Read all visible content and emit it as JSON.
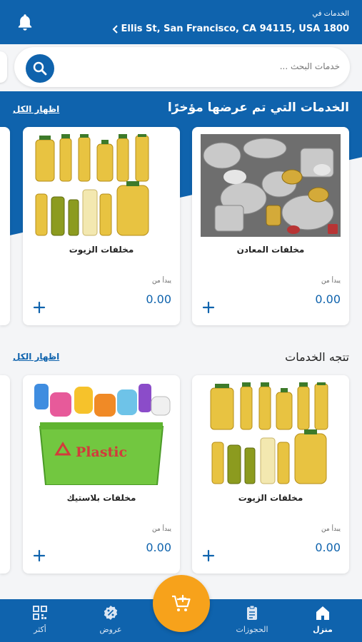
{
  "header": {
    "label": "الخدمات في",
    "address": "Ellis St, San Francisco, CA 94115, USA 1800"
  },
  "search": {
    "placeholder": "خدمات البحث ..."
  },
  "recent": {
    "title": "الخدمات التي تم عرضها مؤخرًا",
    "show_all": "اظهار الكل",
    "cards": [
      {
        "name": "مخلفات المعادن",
        "from": "يبدأ من",
        "price": "0.00",
        "image": "metal-waste"
      },
      {
        "name": "مخلفات الزيوت",
        "from": "يبدأ من",
        "price": "0.00",
        "image": "oil-waste"
      }
    ]
  },
  "trending": {
    "title": "تتجه الخدمات",
    "show_all": "اظهار الكل",
    "cards": [
      {
        "name": "مخلفات الزيوت",
        "from": "يبدأ من",
        "price": "0.00",
        "image": "oil-waste"
      },
      {
        "name": "مخلفات بلاستيك",
        "from": "يبدأ من",
        "price": "0.00",
        "image": "plastic-waste",
        "image_text": "Plastic"
      }
    ]
  },
  "nav": {
    "home": "منزل",
    "bookings": "الحجوزات",
    "offers": "عروض",
    "more": "أكثر"
  },
  "colors": {
    "primary": "#0f63ad",
    "accent": "#f7a21b"
  }
}
